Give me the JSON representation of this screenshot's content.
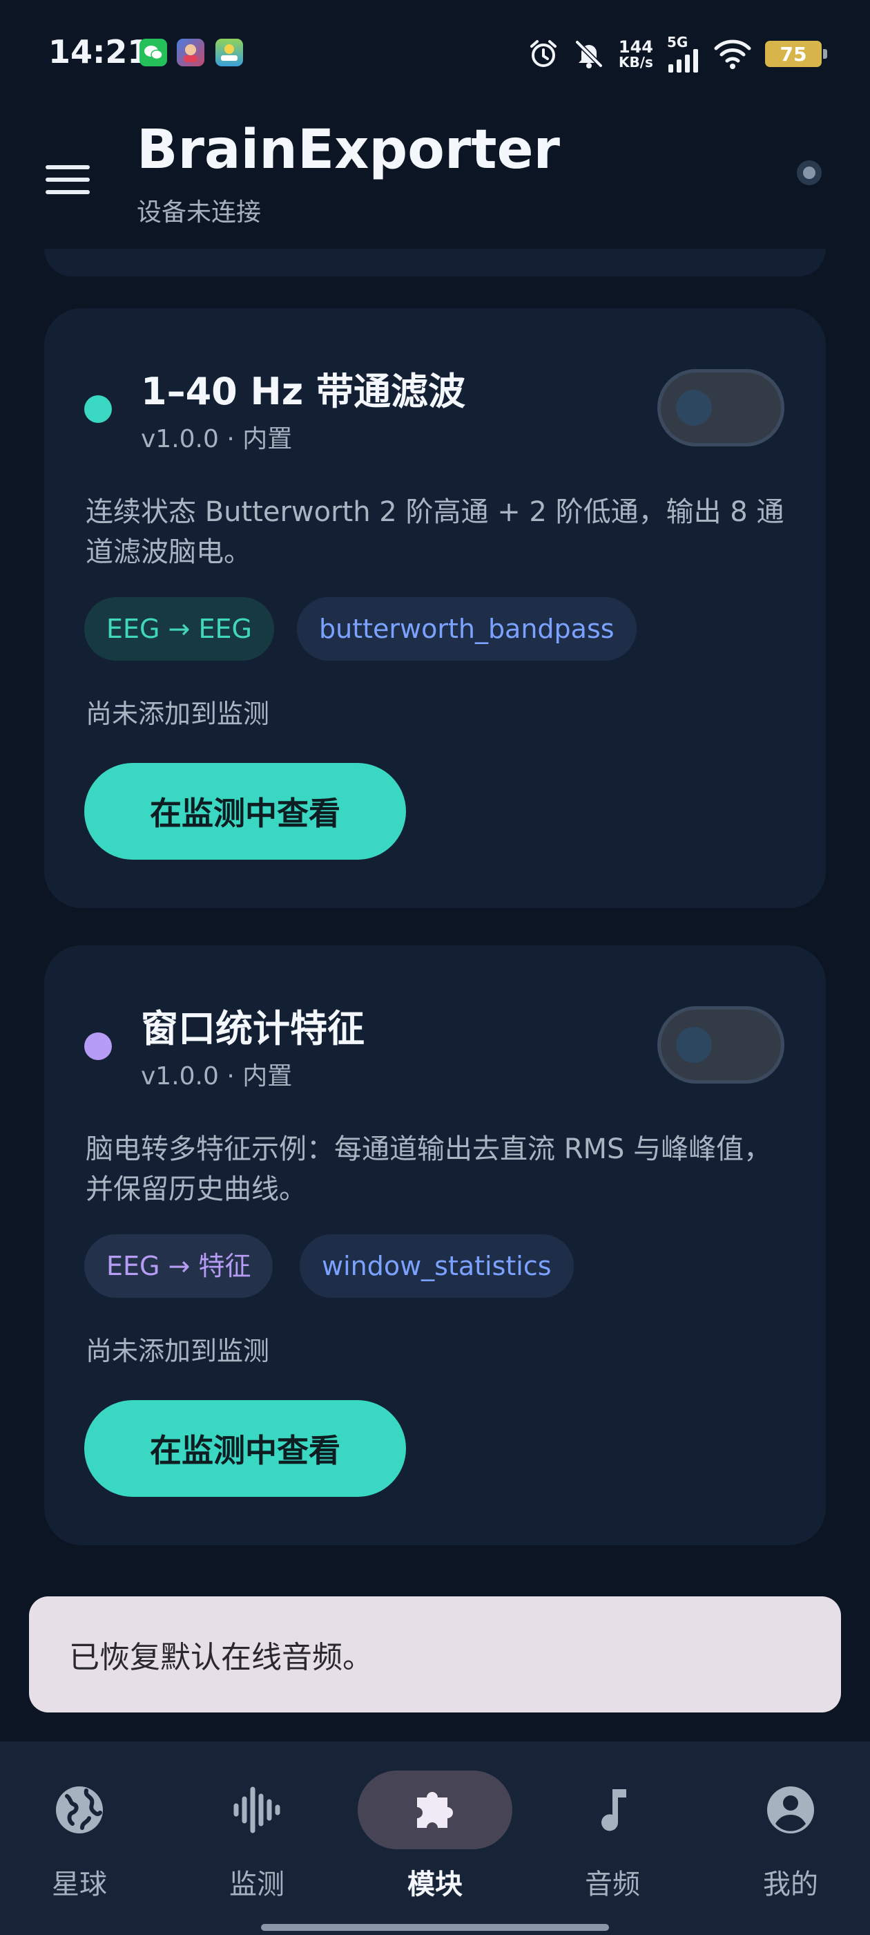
{
  "status_bar": {
    "time": "14:21",
    "net_speed_value": "144",
    "net_speed_unit": "KB/s",
    "network_type": "5G",
    "battery_percent": "75",
    "notification_icons": [
      "wechat-icon",
      "game-app-icon",
      "mini-program-icon"
    ],
    "indicator_icons": [
      "alarm-icon",
      "silent-bell-icon",
      "signal-icon",
      "wifi-icon",
      "battery-icon"
    ]
  },
  "app_bar": {
    "title": "BrainExporter",
    "subtitle": "设备未连接",
    "menu_icon": "hamburger-menu-icon",
    "status_icon": "connection-status-dot"
  },
  "modules": [
    {
      "dot_color": "#3ad8c2",
      "title": "1–40 Hz 带通滤波",
      "version": "v1.0.0 · 内置",
      "description": "连续状态 Butterworth 2 阶高通 + 2 阶低通，输出 8 通道滤波脑电。",
      "io_tag": "EEG → EEG",
      "function_tag": "butterworth_bandpass",
      "status": "尚未添加到监测",
      "action_label": "在监测中查看",
      "enabled": false
    },
    {
      "dot_color": "#b69cf4",
      "title": "窗口统计特征",
      "version": "v1.0.0 · 内置",
      "description": "脑电转多特征示例：每通道输出去直流 RMS 与峰峰值，并保留历史曲线。",
      "io_tag": "EEG → 特征",
      "function_tag": "window_statistics",
      "status": "尚未添加到监测",
      "action_label": "在监测中查看",
      "enabled": false
    }
  ],
  "snackbar": {
    "message": "已恢复默认在线音频。"
  },
  "bottom_nav": {
    "active_index": 2,
    "items": [
      {
        "label": "星球",
        "icon": "globe-icon"
      },
      {
        "label": "监测",
        "icon": "waveform-icon"
      },
      {
        "label": "模块",
        "icon": "puzzle-piece-icon"
      },
      {
        "label": "音频",
        "icon": "music-note-icon"
      },
      {
        "label": "我的",
        "icon": "account-circle-icon"
      }
    ]
  },
  "colors": {
    "background": "#0b1523",
    "card": "#132033",
    "accent_teal": "#3ad8c2",
    "accent_purple": "#b69cf4",
    "link_blue": "#7ba2ff"
  }
}
